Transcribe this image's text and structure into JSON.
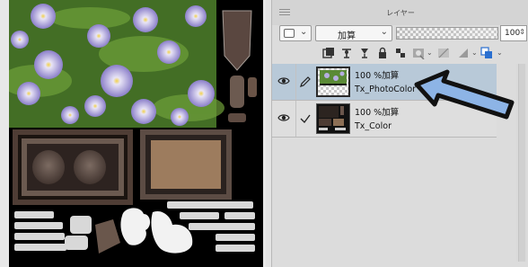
{
  "panel": {
    "title": "レイヤー",
    "blend_mode": "加算",
    "opacity_value": "100"
  },
  "toolbar_icons": [
    "new-raster-layer-icon",
    "clip-to-layer-below-icon",
    "ruler-icon",
    "lock-icon",
    "lock-transparent-pixels-icon",
    "mask-icon",
    "layer-color-icon"
  ],
  "layers": [
    {
      "mode_label": "100 %加算",
      "name": "Tx_PhotoColor",
      "selected": true,
      "visible": true
    },
    {
      "mode_label": "100 %加算",
      "name": "Tx_Color",
      "selected": false,
      "visible": true
    }
  ],
  "colors": {
    "selected_row": "#b8c9d8",
    "arrow_fill": "#8db4e6",
    "arrow_stroke": "#111111"
  }
}
